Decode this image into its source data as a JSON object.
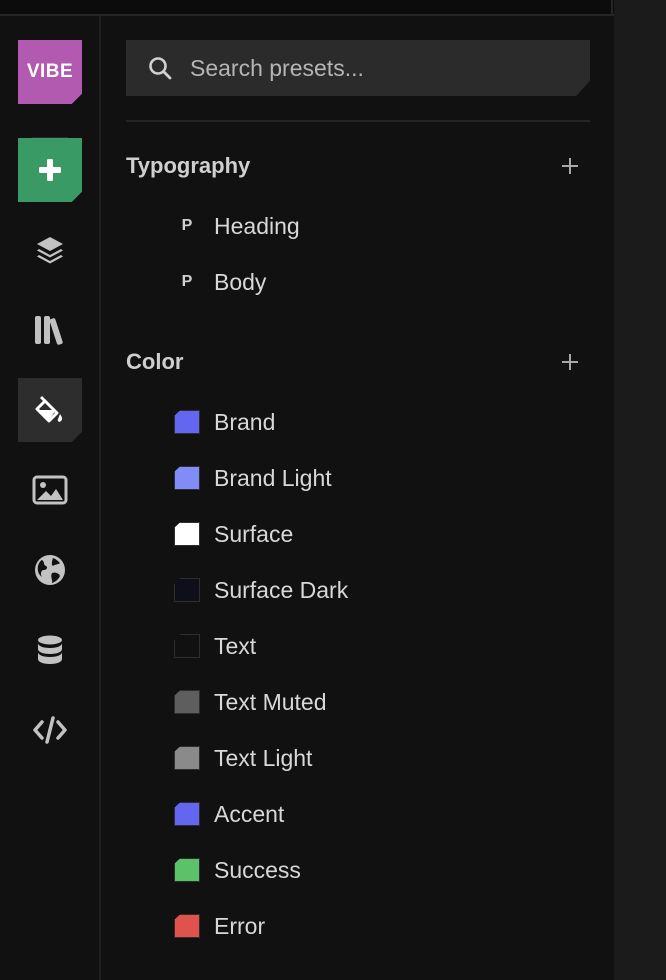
{
  "rail": {
    "logo_label": "VIBE",
    "colors": {
      "logo_bg": "#b25ab0",
      "add_bg": "#3a9a66",
      "active_bg": "#2d2d2d"
    }
  },
  "search": {
    "placeholder": "Search presets...",
    "value": ""
  },
  "typography": {
    "title": "Typography",
    "items": [
      {
        "glyph": "P",
        "label": "Heading"
      },
      {
        "glyph": "P",
        "label": "Body"
      }
    ]
  },
  "color": {
    "title": "Color",
    "items": [
      {
        "label": "Brand",
        "swatch": "#6366f1"
      },
      {
        "label": "Brand Light",
        "swatch": "#818cf8"
      },
      {
        "label": "Surface",
        "swatch": "#ffffff"
      },
      {
        "label": "Surface Dark",
        "swatch": "#0f0f1a"
      },
      {
        "label": "Text",
        "swatch": "#111111"
      },
      {
        "label": "Text Muted",
        "swatch": "#5e5e5e"
      },
      {
        "label": "Text Light",
        "swatch": "#8a8a8a"
      },
      {
        "label": "Accent",
        "swatch": "#6366f1"
      },
      {
        "label": "Success",
        "swatch": "#5cc26a"
      },
      {
        "label": "Error",
        "swatch": "#e0524e"
      }
    ]
  }
}
